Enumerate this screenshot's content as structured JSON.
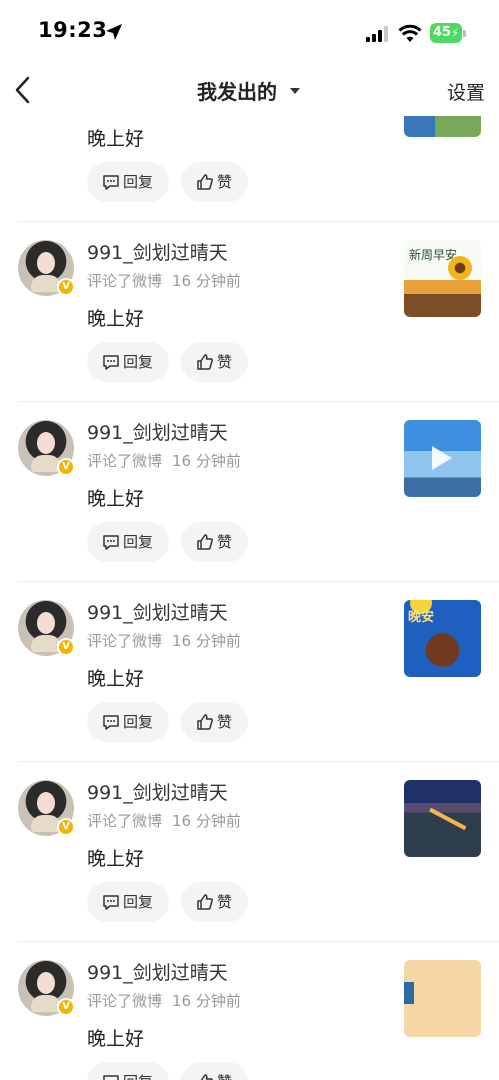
{
  "status_bar": {
    "time": "19:23",
    "battery": "45"
  },
  "nav": {
    "title": "我发出的",
    "settings_label": "设置"
  },
  "colors": {
    "accent": "#f4b400",
    "button_bg": "#f4f4f4",
    "meta_text": "#9a9a9a",
    "battery": "#4cd964"
  },
  "first_item_partial": {
    "comment": "晚上好",
    "reply_label": "回复",
    "like_label": "赞"
  },
  "items": [
    {
      "username": "991_剑划过晴天",
      "action": "评论了微博",
      "time": "16 分钟前",
      "comment": "晚上好",
      "reply_label": "回复",
      "like_label": "赞",
      "thumb_icon": "sunflower-morning-thumbnail",
      "thumb_text": "新周早安"
    },
    {
      "username": "991_剑划过晴天",
      "action": "评论了微博",
      "time": "16 分钟前",
      "comment": "晚上好",
      "reply_label": "回复",
      "like_label": "赞",
      "thumb_icon": "sky-video-thumbnail"
    },
    {
      "username": "991_剑划过晴天",
      "action": "评论了微博",
      "time": "16 分钟前",
      "comment": "晚上好",
      "reply_label": "回复",
      "like_label": "赞",
      "thumb_icon": "sleeping-bear-thumbnail",
      "thumb_text": "晚安"
    },
    {
      "username": "991_剑划过晴天",
      "action": "评论了微博",
      "time": "16 分钟前",
      "comment": "晚上好",
      "reply_label": "回复",
      "like_label": "赞",
      "thumb_icon": "city-night-thumbnail"
    },
    {
      "username": "991_剑划过晴天",
      "action": "评论了微博",
      "time": "16 分钟前",
      "comment": "晚上好",
      "reply_label": "回复",
      "like_label": "赞",
      "thumb_icon": "beige-thumbnail"
    }
  ]
}
